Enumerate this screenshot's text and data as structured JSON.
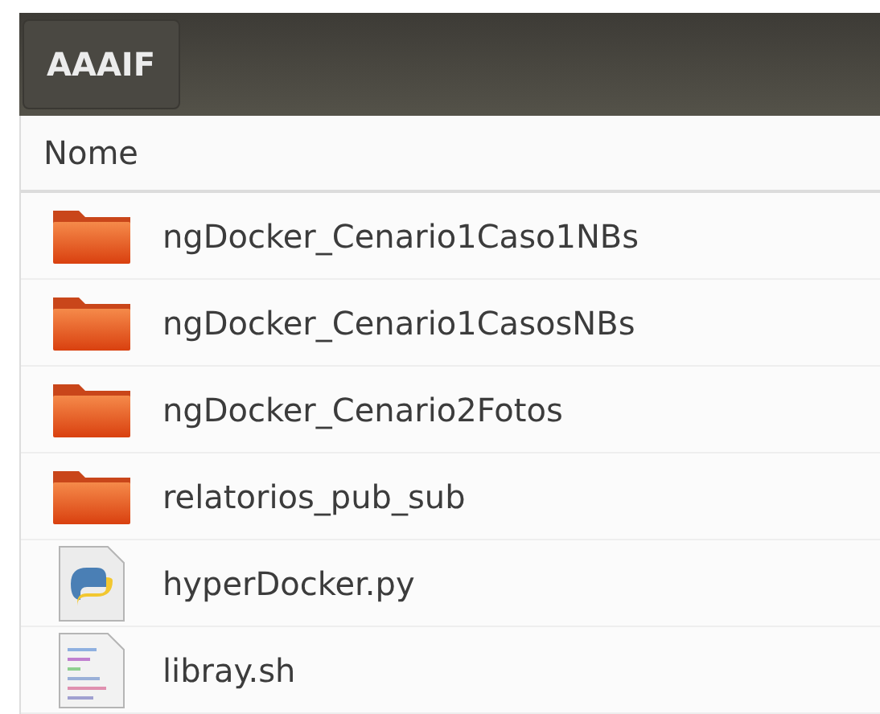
{
  "path_bar": {
    "button": "AAAIF"
  },
  "list": {
    "column": "Nome",
    "items": [
      {
        "name": "ngDocker_Cenario1Caso1NBs",
        "kind": "folder"
      },
      {
        "name": "ngDocker_Cenario1CasosNBs",
        "kind": "folder"
      },
      {
        "name": "ngDocker_Cenario2Fotos",
        "kind": "folder"
      },
      {
        "name": "relatorios_pub_sub",
        "kind": "folder"
      },
      {
        "name": "hyperDocker.py",
        "kind": "python"
      },
      {
        "name": "libray.sh",
        "kind": "script"
      }
    ]
  }
}
